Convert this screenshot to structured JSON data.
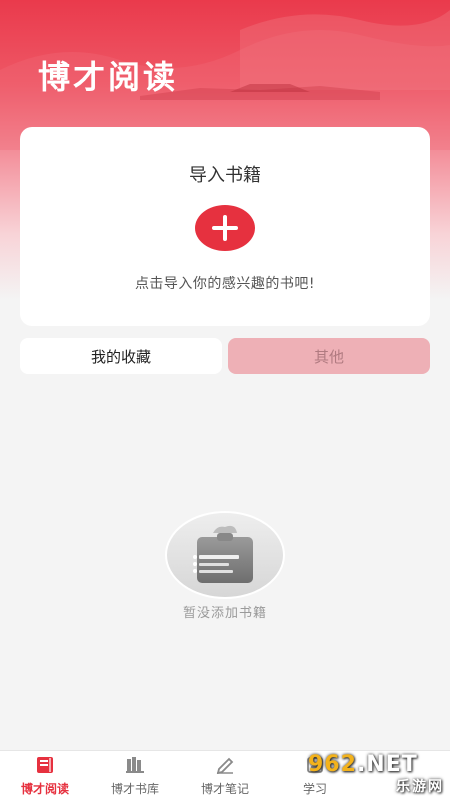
{
  "header": {
    "app_title": "博才阅读"
  },
  "import_card": {
    "title": "导入书籍",
    "add_icon": "plus-icon",
    "hint": "点击导入你的感兴趣的书吧!"
  },
  "tabs": [
    {
      "label": "我的收藏",
      "selected": true
    },
    {
      "label": "其他",
      "selected": false
    }
  ],
  "empty_state": {
    "icon": "empty-clipboard-icon",
    "text": "暂没添加书籍"
  },
  "bottom_nav": [
    {
      "label": "博才阅读",
      "icon": "book-icon",
      "active": true
    },
    {
      "label": "博才书库",
      "icon": "bookshelf-icon",
      "active": false
    },
    {
      "label": "博才笔记",
      "icon": "pen-icon",
      "active": false
    },
    {
      "label": "学习",
      "icon": "study-icon",
      "active": false
    }
  ],
  "watermark": {
    "top_prefix": "",
    "top_num": "962",
    "top_suffix": ".NET",
    "bottom": "乐游网"
  },
  "colors": {
    "accent": "#e6313f",
    "tab_other_bg": "#eeb0b6",
    "background": "#f4f4f4"
  }
}
